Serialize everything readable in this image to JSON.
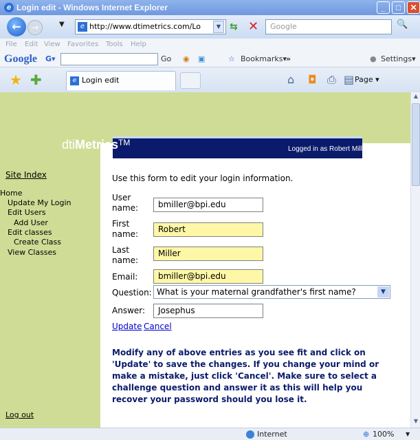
{
  "browser": {
    "title": "Login edit - Windows Internet Explorer",
    "address": "http://www.dtimetrics.com/Lo",
    "search_placeholder": "Google",
    "menu": [
      "File",
      "Edit",
      "View",
      "Favorites",
      "Tools",
      "Help"
    ],
    "google_toolbar": {
      "logo": "Google",
      "g_button": "G▾",
      "go": "Go",
      "bookmarks": "Bookmarks▾",
      "more": "»",
      "settings": "Settings▾"
    },
    "tab_label": "Login edit",
    "page_button": "Page ▾",
    "status": {
      "zone": "Internet",
      "zoom": "100%"
    },
    "colors": {
      "titlebar": "#7aa2e3",
      "accent": "#0b1b6b",
      "sidebar": "#cfdc96",
      "highlight": "#fdf7a7"
    }
  },
  "site": {
    "logo_prefix": "dti",
    "logo_bold": "Metrics",
    "logo_tm": "TM",
    "logged_in": "Logged in as Robert Miller."
  },
  "sidebar": {
    "site_index": "Site Index",
    "items": [
      {
        "label": "Home"
      },
      {
        "label": "Update My Login"
      },
      {
        "label": "Edit Users"
      },
      {
        "label": "Add User"
      },
      {
        "label": "Edit classes"
      },
      {
        "label": "Create Class"
      },
      {
        "label": "View Classes"
      }
    ],
    "logout": "Log out"
  },
  "form": {
    "intro": "Use this form to edit your login information.",
    "username_label": "User name:",
    "username": "bmiller@bpi.edu",
    "firstname_label": "First name:",
    "firstname": "Robert",
    "lastname_label": "Last name:",
    "lastname": "Miller",
    "email_label": "Email:",
    "email": "bmiller@bpi.edu",
    "question_label": "Question:",
    "question": "What is your maternal grandfather's first name?",
    "answer_label": "Answer:",
    "answer": "Josephus",
    "update": "Update",
    "cancel": "Cancel",
    "help": "Modify any of above entries as you see fit and click on 'Update' to save the changes. If you change your mind or make a mistake, just click 'Cancel'. Make sure to select a challenge question and answer it as this will help you recover your password should you lose it."
  }
}
